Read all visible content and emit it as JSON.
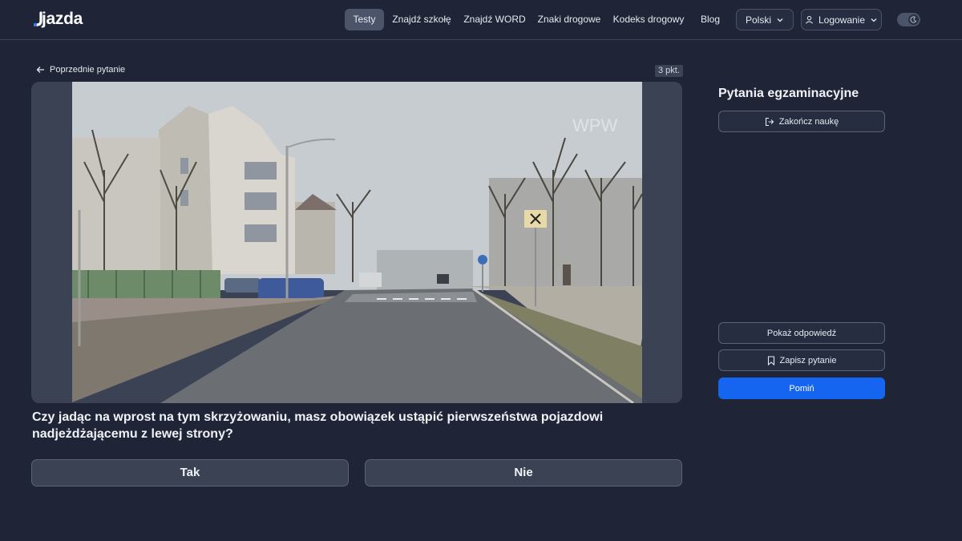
{
  "header": {
    "logo_text": "jazda",
    "nav": [
      {
        "label": "Testy",
        "active": true
      },
      {
        "label": "Znajdź szkołę"
      },
      {
        "label": "Znajdź WORD"
      },
      {
        "label": "Znaki drogowe"
      },
      {
        "label": "Kodeks drogowy"
      },
      {
        "label": "Blog"
      }
    ],
    "language": "Polski",
    "login": "Logowanie"
  },
  "question": {
    "prev_label": "Poprzednie pytanie",
    "points": "3 pkt.",
    "text": "Czy jadąc na wprost na tym skrzyżowaniu, masz obowiązek ustąpić pierwszeństwa pojazdowi nadjeżdżającemu z lewej strony?",
    "media_watermark": "WPW",
    "answers": [
      "Tak",
      "Nie"
    ]
  },
  "sidebar": {
    "title": "Pytania egzaminacyjne",
    "finish_label": "Zakończ naukę",
    "show_answer_label": "Pokaż odpowiedź",
    "save_label": "Zapisz pytanie",
    "skip_label": "Pomiń"
  },
  "colors": {
    "background": "#1f2537",
    "primary": "#1565f0",
    "panel": "#3a4254"
  }
}
